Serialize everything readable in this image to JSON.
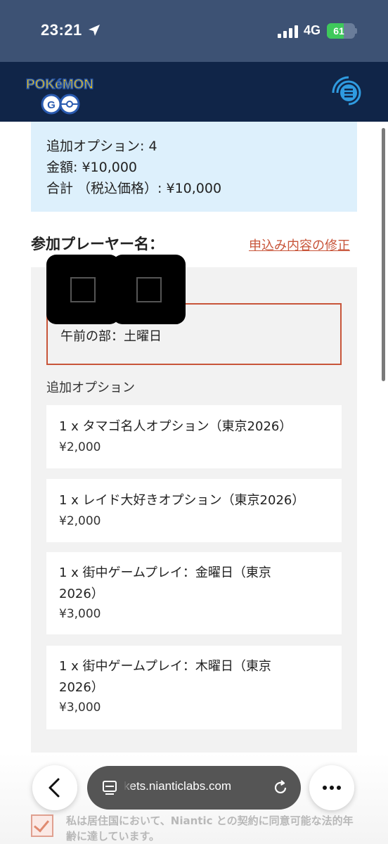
{
  "status_bar": {
    "time": "23:21",
    "network": "4G",
    "battery": "61",
    "battery_level": 0.61
  },
  "header": {
    "logo_alt": "Pokémon GO",
    "logo_top": "POKéMON",
    "logo_bottom": "GO"
  },
  "summary": {
    "options_line": "追加オプション: 4",
    "amount_line": "金額: ¥10,000",
    "total_line": "合計 （税込価格）: ¥10,000"
  },
  "players": {
    "title": "参加プレーヤー名：",
    "edit_link": "申込み内容の修正"
  },
  "session": "午前の部：土曜日",
  "options_label": "追加オプション",
  "options": [
    {
      "name_lines": [
        "1 x タマゴ名人オプション（東京2026）"
      ],
      "price": "¥2,000"
    },
    {
      "name_lines": [
        "1 x レイド大好きオプション（東京2026）"
      ],
      "price": "¥2,000"
    },
    {
      "name_lines": [
        "1 x 街中ゲームプレイ：金曜日（東京",
        "2026）"
      ],
      "price": "¥3,000"
    },
    {
      "name_lines": [
        "1 x 街中ゲームプレイ：木曜日（東京",
        "2026）"
      ],
      "price": "¥3,000"
    }
  ],
  "consent": "私は居住国において、Niantic との契約に同意可能な法的年齢に達しています。",
  "browser": {
    "url": "kets.nianticlabs.com"
  },
  "colors": {
    "status_bar": "#3d5274",
    "header": "#102548",
    "summary_bg": "#ddf0fc",
    "accent": "#c8553a",
    "panel": "#f2f2f2"
  },
  "icons": [
    "location-arrow-icon",
    "signal-icon",
    "battery-icon",
    "menu-icon",
    "tabs-icon",
    "reload-icon",
    "back-icon",
    "more-icon",
    "check-icon"
  ]
}
